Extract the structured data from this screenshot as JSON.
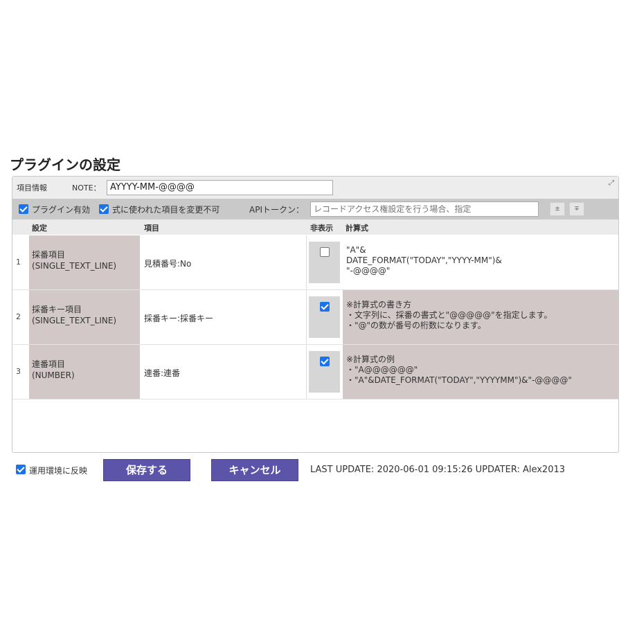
{
  "page_title": "プラグインの設定",
  "toolbar": {
    "item_info_label": "項目情報",
    "note_label": "NOTE：",
    "note_value": "AYYYY-MM-@@@@",
    "resize_icon": "expand-icon",
    "plugin_enabled_label": "プラグイン有効",
    "plugin_enabled": true,
    "lock_items_label": "式に使われた項目を変更不可",
    "lock_items": true,
    "api_token_label": "APIトークン：",
    "api_token_placeholder": "レコードアクセス権設定を行う場合、指定",
    "btn_up": "±",
    "btn_down": "∓"
  },
  "table": {
    "headers": {
      "settings": "設定",
      "item": "項目",
      "hidden": "非表示",
      "formula": "計算式"
    },
    "rows": [
      {
        "num": "1",
        "set1": "採番項目",
        "set2": "(SINGLE_TEXT_LINE)",
        "item": "見積番号:No",
        "hidden": false,
        "formula": [
          "\"A\"&",
          "DATE_FORMAT(\"TODAY\",\"YYYY-MM\")&",
          "\"-@@@@\""
        ]
      },
      {
        "num": "2",
        "set1": "採番キー項目",
        "set2": "(SINGLE_TEXT_LINE)",
        "item": "採番キー:採番キー",
        "hidden": true,
        "formula": [
          "※計算式の書き方",
          "・文字列に、採番の書式と\"@@@@@\"を指定します。",
          "・\"@\"の数が番号の桁数になります。"
        ]
      },
      {
        "num": "3",
        "set1": "連番項目",
        "set2": "(NUMBER)",
        "item": "連番:連番",
        "hidden": true,
        "formula": [
          "※計算式の例",
          "・\"A@@@@@@\"",
          "・\"A\"&DATE_FORMAT(\"TODAY\",\"YYYYMM\")&\"-@@@@\""
        ]
      }
    ]
  },
  "footer": {
    "apply_label": "運用環境に反映",
    "apply_checked": true,
    "save_label": "保存する",
    "cancel_label": "キャンセル",
    "last_update": "LAST UPDATE: 2020-06-01 09:15:26 UPDATER: Alex2013"
  },
  "colors": {
    "button": "#5b54a8",
    "hint_bg": "#d3c8c8",
    "checkbox": "#1a73e8"
  }
}
